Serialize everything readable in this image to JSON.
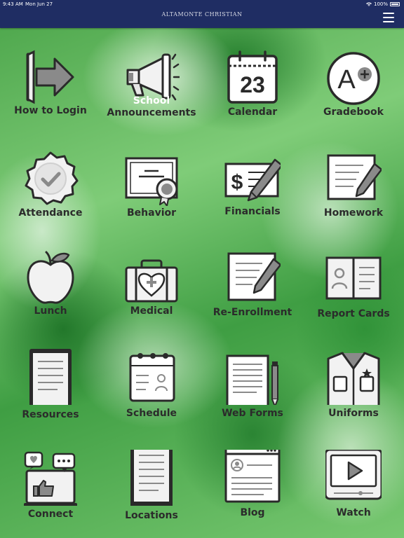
{
  "status_bar": {
    "time": "9:43 AM",
    "date": "Mon Jun 27",
    "battery": "100%"
  },
  "header": {
    "title": "ALTAMONTE CHRISTIAN",
    "menu_icon": "hamburger-menu-icon"
  },
  "tiles": [
    {
      "label": "How to Login",
      "icon": "login-arrow-icon"
    },
    {
      "label": "School",
      "label2": "Announcements",
      "icon": "megaphone-icon"
    },
    {
      "label": "Calendar",
      "icon": "calendar-icon",
      "calendar_day": "23"
    },
    {
      "label": "Gradebook",
      "icon": "a-plus-grade-icon",
      "grade": "A"
    },
    {
      "label": "Attendance",
      "icon": "checkmark-badge-icon"
    },
    {
      "label": "Behavior",
      "icon": "certificate-icon"
    },
    {
      "label": "Financials",
      "icon": "dollar-check-icon",
      "symbol": "$"
    },
    {
      "label": "Homework",
      "icon": "homework-pencil-icon"
    },
    {
      "label": "Lunch",
      "icon": "apple-icon"
    },
    {
      "label": "Medical",
      "icon": "medical-kit-icon"
    },
    {
      "label": "Re-Enrollment",
      "icon": "document-pencil-icon"
    },
    {
      "label": "Report Cards",
      "icon": "report-card-icon"
    },
    {
      "label": "Resources",
      "icon": "tablet-icon"
    },
    {
      "label": "Schedule",
      "icon": "schedule-icon"
    },
    {
      "label": "Web Forms",
      "icon": "web-form-icon"
    },
    {
      "label": "Uniforms",
      "icon": "uniform-shirt-icon"
    },
    {
      "label": "Connect",
      "icon": "social-connect-icon"
    },
    {
      "label": "Locations",
      "icon": "locations-tablet-icon"
    },
    {
      "label": "Blog",
      "icon": "blog-window-icon"
    },
    {
      "label": "Watch",
      "icon": "video-play-icon"
    }
  ],
  "colors": {
    "navbar": "#1f2d63",
    "icon_stroke": "#222222",
    "icon_fill": "#f2f2f2",
    "icon_accent": "#8a8a8a"
  }
}
